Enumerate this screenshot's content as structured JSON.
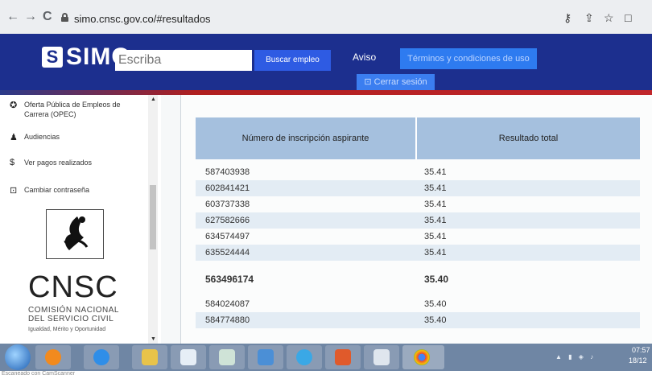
{
  "browser": {
    "back_icon": "←",
    "forward_icon": "→",
    "reload_icon": "C",
    "url": "simo.cnsc.gov.co/#resultados"
  },
  "header": {
    "logo_text": "SIMO",
    "search_placeholder": "Escriba",
    "search_button": "Buscar empleo",
    "aviso": "Aviso",
    "terminos": "Términos y condiciones de uso",
    "cerrar_sesion": "Cerrar sesión",
    "brand_color": "#1c2f8e",
    "accent_color": "#c0262b"
  },
  "sidebar": {
    "items": [
      {
        "icon": "globe-icon",
        "label": "Oferta Pública de Empleos de Carrera (OPEC)"
      },
      {
        "icon": "audience-icon",
        "label": "Audiencias"
      },
      {
        "icon": "dollar-icon",
        "label": "Ver pagos realizados"
      },
      {
        "icon": "lock-icon",
        "label": "Cambiar contraseña"
      }
    ],
    "cnsc_title": "CNSC",
    "cnsc_line1": "COMISIÓN NACIONAL",
    "cnsc_line2": "DEL SERVICIO CIVIL",
    "cnsc_tagline": "Igualdad, Mérito y Oportunidad"
  },
  "table": {
    "col1_header": "Número de inscripción aspirante",
    "col2_header": "Resultado total",
    "rows": [
      {
        "id": "587403938",
        "score": "35.41"
      },
      {
        "id": "602841421",
        "score": "35.41"
      },
      {
        "id": "603737338",
        "score": "35.41"
      },
      {
        "id": "627582666",
        "score": "35.41"
      },
      {
        "id": "634574497",
        "score": "35.41"
      },
      {
        "id": "635524444",
        "score": "35.41"
      },
      {
        "id": "563496174",
        "score": "35.40"
      },
      {
        "id": "584024087",
        "score": "35.40"
      },
      {
        "id": "584774880",
        "score": "35.40"
      }
    ]
  },
  "taskbar": {
    "time": "07:57",
    "date": "18/12"
  },
  "scanner_note": "Escaneado con CamScanner"
}
